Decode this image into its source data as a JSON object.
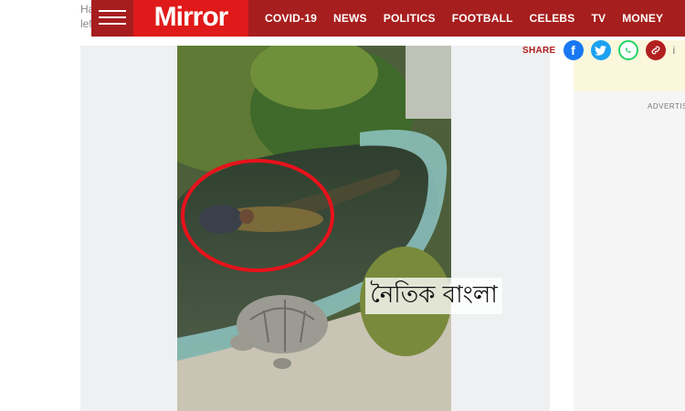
{
  "page": {
    "teaser_line_1": "Ha",
    "teaser_line_2": "lef"
  },
  "header": {
    "logo_text": "Mirror",
    "nav": [
      "COVID-19",
      "NEWS",
      "POLITICS",
      "FOOTBALL",
      "CELEBS",
      "TV",
      "MONEY"
    ]
  },
  "share": {
    "label": "SHARE",
    "icons": [
      "facebook-icon",
      "twitter-icon",
      "whatsapp-icon",
      "link-icon"
    ],
    "more": "i"
  },
  "sidebar": {
    "advert_label": "ADVERTIS"
  },
  "media": {
    "watermark_text": "নৈতিক বাংলা",
    "accent_color": "#e01a1a",
    "brand_header_color": "#a71e1e"
  }
}
